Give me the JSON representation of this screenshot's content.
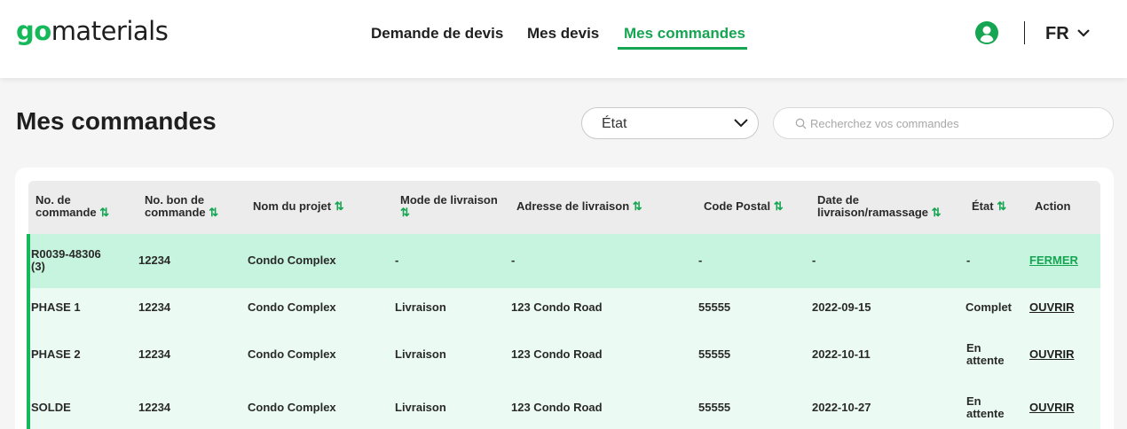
{
  "header": {
    "logo_go": "go",
    "logo_rest": "materials",
    "nav": [
      "Demande de devis",
      "Mes devis",
      "Mes commandes"
    ],
    "language": "FR"
  },
  "page": {
    "title": "Mes commandes",
    "state_filter": "État",
    "search_placeholder": "Recherchez vos commandes"
  },
  "table": {
    "columns": [
      [
        "No. de",
        "commande"
      ],
      [
        "No. bon de",
        "commande"
      ],
      [
        "Nom du projet"
      ],
      [
        "Mode de livraison"
      ],
      [
        "Adresse de livraison"
      ],
      [
        "Code Postal"
      ],
      [
        "Date de",
        "livraison/ramassage"
      ],
      [
        "État"
      ],
      [
        "Action"
      ]
    ],
    "sort_icon": "⇅",
    "rows": [
      {
        "order": [
          "R0039-48306",
          "(3)"
        ],
        "po": "12234",
        "project": "Condo Complex",
        "mode": "-",
        "address": "-",
        "postal": "-",
        "date": "-",
        "state": [
          "-"
        ],
        "action": "FERMER"
      },
      {
        "order": [
          "PHASE 1"
        ],
        "po": "12234",
        "project": "Condo Complex",
        "mode": "Livraison",
        "address": "123 Condo Road",
        "postal": "55555",
        "date": "2022-09-15",
        "state": [
          "Complet"
        ],
        "action": "OUVRIR"
      },
      {
        "order": [
          "PHASE 2"
        ],
        "po": "12234",
        "project": "Condo Complex",
        "mode": "Livraison",
        "address": "123 Condo Road",
        "postal": "55555",
        "date": "2022-10-11",
        "state": [
          "En",
          "attente"
        ],
        "action": "OUVRIR"
      },
      {
        "order": [
          "SOLDE"
        ],
        "po": "12234",
        "project": "Condo Complex",
        "mode": "Livraison",
        "address": "123 Condo Road",
        "postal": "55555",
        "date": "2022-10-27",
        "state": [
          "En",
          "attente"
        ],
        "action": "OUVRIR"
      }
    ]
  },
  "colors": {
    "accent": "#16a552",
    "highlight": "#c6f4de",
    "subrow": "#ebfbf3"
  },
  "icons": [
    "user-circle-icon",
    "chevron-down-icon",
    "search-icon",
    "sort-icon"
  ]
}
